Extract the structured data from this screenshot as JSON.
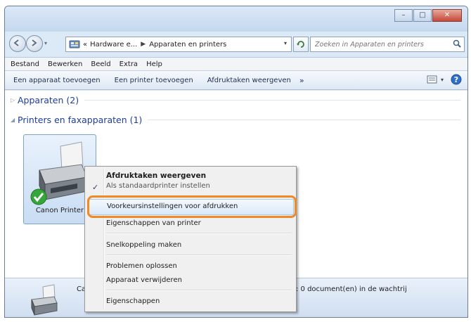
{
  "titlebar": {
    "buttons": [
      "minimize",
      "maximize",
      "close"
    ]
  },
  "navigation": {
    "address": {
      "overflow": "«",
      "crumbs": [
        "Hardware e...",
        "Apparaten en printers"
      ]
    },
    "search": {
      "placeholder": "Zoeken in Apparaten en printers"
    }
  },
  "menubar": {
    "items": [
      "Bestand",
      "Bewerken",
      "Beeld",
      "Extra",
      "Help"
    ]
  },
  "commandbar": {
    "items": [
      "Een apparaat toevoegen",
      "Een printer toevoegen",
      "Afdruktaken weergeven"
    ],
    "more": "»"
  },
  "groups": [
    {
      "title": "Apparaten (2)",
      "expanded": false
    },
    {
      "title": "Printers en faxapparaten (1)",
      "expanded": true
    }
  ],
  "device": {
    "name": "Canon Printer",
    "status_icon": "default-check-icon"
  },
  "statusbar": {
    "name_partial": "Car",
    "docs": ": 0 document(en) in de wachtrij"
  },
  "context_menu": {
    "items": [
      {
        "label": "Afdruktaken weergeven",
        "bold": true
      },
      {
        "label": "Als standaardprinter instellen",
        "checked": true,
        "partially_hidden": true
      },
      {
        "label": "Voorkeursinstellingen voor afdrukken",
        "highlighted": true
      },
      {
        "label": "Eigenschappen van printer"
      },
      {
        "label": "Snelkoppeling maken"
      },
      {
        "label": "Problemen oplossen"
      },
      {
        "label": "Apparaat verwijderen"
      },
      {
        "label": "Eigenschappen"
      }
    ]
  },
  "colors": {
    "highlight_callout": "#f08a24",
    "group_title": "#1e3d9a",
    "window_chrome": "#dce9f7"
  }
}
